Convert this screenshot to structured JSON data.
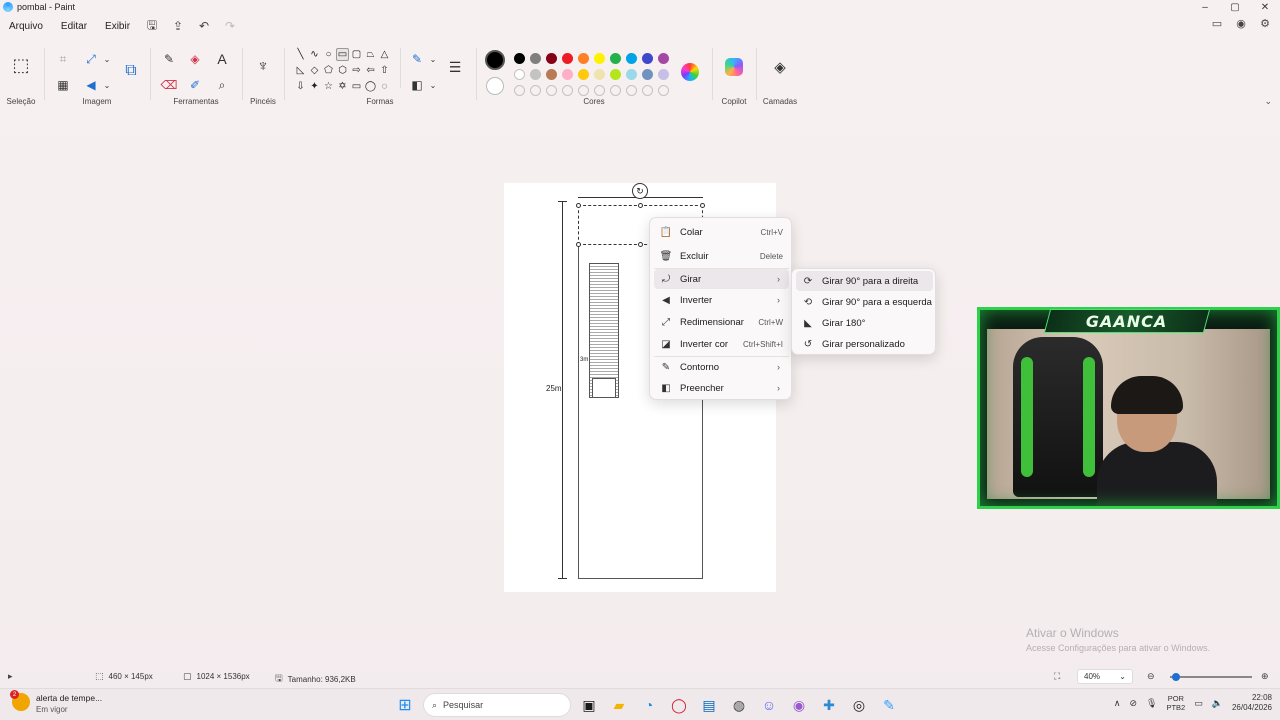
{
  "window": {
    "title": "pombal - Paint",
    "controls": [
      "–",
      "▢",
      "✕"
    ]
  },
  "menu": {
    "items": [
      "Arquivo",
      "Editar",
      "Exibir"
    ]
  },
  "ribbon": {
    "groups": {
      "selection": "Seleção",
      "image": "Imagem",
      "tools": "Ferramentas",
      "brushes": "Pincéis",
      "shapes": "Formas",
      "colors": "Cores",
      "copilot": "Copilot",
      "layers": "Camadas"
    },
    "palette_row1": [
      "#000000",
      "#7f7f7f",
      "#880015",
      "#ed1c24",
      "#ff7f27",
      "#fff200",
      "#22b14c",
      "#00a2e8",
      "#3f48cc",
      "#a349a4"
    ],
    "palette_row2": [
      "#ffffff",
      "#c3c3c3",
      "#b97a57",
      "#ffaec9",
      "#ffc90e",
      "#efe4b0",
      "#b5e61d",
      "#99d9ea",
      "#7092be",
      "#c8bfe7"
    ],
    "primary_color": "#000000",
    "secondary_color": "#ffffff"
  },
  "canvas": {
    "label_25m": "25m",
    "label_3m": "3m"
  },
  "context_menu": {
    "items": [
      {
        "label": "Colar",
        "shortcut": "Ctrl+V",
        "icon": "paste-icon"
      },
      {
        "label": "Excluir",
        "shortcut": "Delete",
        "icon": "delete-icon"
      },
      {
        "label": "Girar",
        "shortcut": "",
        "icon": "rotate-icon"
      },
      {
        "label": "Inverter",
        "shortcut": "",
        "icon": "flip-icon"
      },
      {
        "label": "Redimensionar",
        "shortcut": "Ctrl+W",
        "icon": "resize-icon"
      },
      {
        "label": "Inverter cor",
        "shortcut": "Ctrl+Shift+I",
        "icon": "invert-color-icon"
      },
      {
        "label": "Contorno",
        "shortcut": "",
        "icon": "outline-icon"
      },
      {
        "label": "Preencher",
        "shortcut": "",
        "icon": "fill-icon"
      }
    ]
  },
  "rotate_submenu": {
    "items": [
      "Girar 90° para a direita",
      "Girar 90° para a esquerda",
      "Girar 180°",
      "Girar personalizado"
    ]
  },
  "webcam": {
    "logo": "GAANCA"
  },
  "watermark": {
    "title": "Ativar o Windows",
    "subtitle": "Acesse Configurações para ativar o Windows."
  },
  "status": {
    "selection_size": "460 × 145px",
    "canvas_size": "1024 × 1536px",
    "file_size": "Tamanho: 936,2KB",
    "zoom": "40%"
  },
  "taskbar": {
    "weather_title": "alerta de tempe...",
    "weather_sub": "Em vigor",
    "weather_badge": "2",
    "search_placeholder": "Pesquisar",
    "lang_top": "POR",
    "lang_bottom": "PTB2",
    "time": "22:08",
    "date": "26/04/2026"
  }
}
